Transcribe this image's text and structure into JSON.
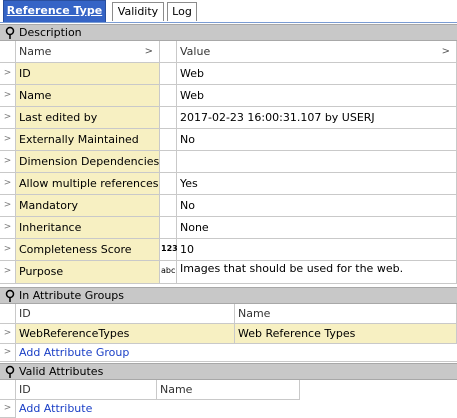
{
  "tabs": [
    {
      "label": "Reference Type",
      "active": true
    },
    {
      "label": "Validity",
      "active": false
    },
    {
      "label": "Log",
      "active": false
    }
  ],
  "description": {
    "section_title": "Description",
    "col_name": "Name",
    "col_value": "Value",
    "rows": [
      {
        "name": "ID",
        "value": "Web",
        "type_icon": ""
      },
      {
        "name": "Name",
        "value": "Web",
        "type_icon": ""
      },
      {
        "name": "Last edited by",
        "value": "2017-02-23 16:00:31.107 by USERJ",
        "type_icon": ""
      },
      {
        "name": "Externally Maintained",
        "value": "No",
        "type_icon": ""
      },
      {
        "name": "Dimension Dependencies",
        "value": "",
        "type_icon": ""
      },
      {
        "name": "Allow multiple references",
        "value": "Yes",
        "type_icon": ""
      },
      {
        "name": "Mandatory",
        "value": "No",
        "type_icon": ""
      },
      {
        "name": "Inheritance",
        "value": "None",
        "type_icon": ""
      },
      {
        "name": "Completeness Score",
        "value": "10",
        "type_icon": "123"
      },
      {
        "name": "Purpose",
        "value": "Images that should be used for the web.",
        "type_icon": "abc"
      }
    ]
  },
  "attribute_groups": {
    "section_title": "In Attribute Groups",
    "col_id": "ID",
    "col_name": "Name",
    "rows": [
      {
        "id": "WebReferenceTypes",
        "name": "Web Reference Types"
      }
    ],
    "add_label": "Add Attribute Group"
  },
  "valid_attributes": {
    "section_title": "Valid Attributes",
    "col_id": "ID",
    "col_name": "Name",
    "add_label": "Add Attribute"
  },
  "colors": {
    "tab_active": "#3564c6",
    "row_yellow": "#f7f0c2",
    "section_header": "#c8c8c8",
    "link": "#1a3fc6"
  }
}
